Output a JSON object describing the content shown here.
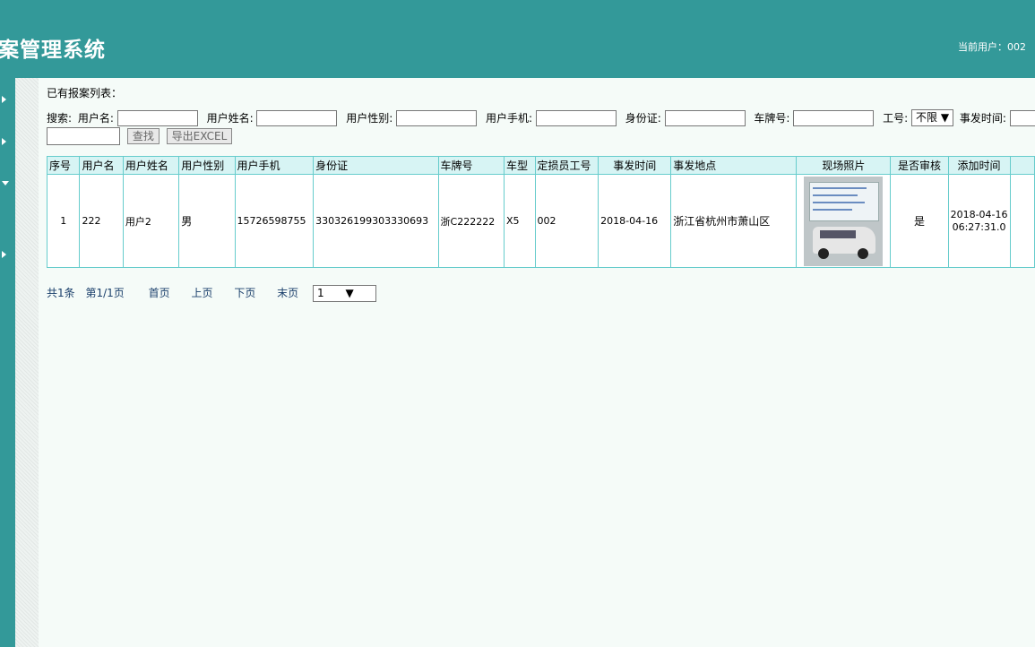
{
  "header": {
    "title": "案管理系统",
    "current_user": "当前用户：002"
  },
  "main": {
    "list_title": "已有报案列表：",
    "search": {
      "prefix": "搜索:",
      "labels": {
        "username": "用户名:",
        "realname": "用户姓名:",
        "gender": "用户性别:",
        "phone": "用户手机:",
        "idcard": "身份证:",
        "plate": "车牌号:",
        "workno": "工号:",
        "time": "事发时间:"
      },
      "workno_select": "不限",
      "find_button": "查找",
      "export_button": "导出EXCEL"
    },
    "table": {
      "headers": [
        "序号",
        "用户名",
        "用户姓名",
        "用户性别",
        "用户手机",
        "身份证",
        "车牌号",
        "车型",
        "定损员工号",
        "事发时间",
        "事发地点",
        "现场照片",
        "是否审核",
        "添加时间"
      ],
      "rows": [
        {
          "no": "1",
          "username": "222",
          "realname": "用户2",
          "gender": "男",
          "phone": "15726598755",
          "idcard": "330326199303330693",
          "plate": "浙C222222",
          "model": "X5",
          "workno": "002",
          "date": "2018-04-16",
          "place": "浙江省杭州市萧山区",
          "reviewed": "是",
          "added_date": "2018-04-16",
          "added_time": "06:27:31.0"
        }
      ]
    },
    "pager": {
      "total": "共1条",
      "page": "第1/1页",
      "first": "首页",
      "prev": "上页",
      "next": "下页",
      "last": "末页",
      "select": "1"
    }
  }
}
